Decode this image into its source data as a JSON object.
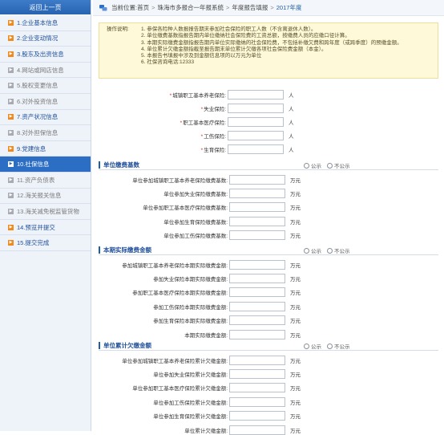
{
  "sidebar": {
    "back_label": "返回上一页",
    "items": [
      {
        "label": "1.企业基本信息",
        "state": "done"
      },
      {
        "label": "2.企业变动情况",
        "state": "done"
      },
      {
        "label": "3.股东及出资信息",
        "state": "done"
      },
      {
        "label": "4.网站或网店信息",
        "state": "todo"
      },
      {
        "label": "5.股权变更信息",
        "state": "todo"
      },
      {
        "label": "6.对外投资信息",
        "state": "todo"
      },
      {
        "label": "7.资产状况信息",
        "state": "done"
      },
      {
        "label": "8.对外担保信息",
        "state": "todo"
      },
      {
        "label": "9.党建信息",
        "state": "done"
      },
      {
        "label": "10.社保信息",
        "state": "active"
      },
      {
        "label": "11.资产负债表",
        "state": "todo"
      },
      {
        "label": "12.海关报关信息",
        "state": "todo"
      },
      {
        "label": "13.海关减免税监管货物",
        "state": "todo"
      },
      {
        "label": "14.预览并提交",
        "state": "done"
      },
      {
        "label": "15.提交完成",
        "state": "done"
      }
    ]
  },
  "breadcrumb": {
    "prefix": "当前位置:",
    "parts": [
      "首页",
      "珠海市多报合一年报系统",
      "年度报告填报"
    ],
    "current": "2017年度"
  },
  "notice": {
    "label": "操作说明:",
    "lines": [
      "1. 参保各险种人数报报告期末参加社会保险的职工人数（不含离退休人数）。",
      "2. 单位缴费基数指报告期内单位缴纳社会保险费的工资总额，按缴费人员的应缴口径计算。",
      "3. 本期实际缴费金额指报告期内单位实际缴纳的社会保险费，不包括补缴欠费和跨年度（或跨季度）的预缴金额。",
      "4. 单位累计欠缴金额指截至报告期末单位累计欠缴各项社会保险费金额（本金）。",
      "5. 本报告书填报中涉及到金额信息项的以万元为单位",
      "6. 社保咨询电话:12333"
    ]
  },
  "insured": {
    "unit": "人",
    "fields": [
      "城镇职工基本养老保险:",
      "失业保险:",
      "职工基本医疗保险:",
      "工伤保险:",
      "生育保险:"
    ]
  },
  "radio": {
    "public": "公示",
    "private": "不公示"
  },
  "money_unit": "万元",
  "sections": [
    {
      "title": "单位缴费基数",
      "fields": [
        "单位参加城镇职工基本养老保险缴费基数:",
        "单位参加失业保险缴费基数:",
        "单位参加职工基本医疗保险缴费基数:",
        "单位参加生育保险缴费基数:",
        "单位参加工伤保险缴费基数:"
      ]
    },
    {
      "title": "本期实际缴费金额",
      "fields": [
        "参加城镇职工基本养老保险本期实际缴费金额:",
        "参加失业保险本期实际缴费金额:",
        "参加职工基本医疗保险本期实际缴费金额:",
        "参加工伤保险本期实际缴费金额:",
        "参加生育保险本期实际缴费金额:",
        "本期实际缴费金额:"
      ]
    },
    {
      "title": "单位累计欠缴金额",
      "fields": [
        "单位参加城镇职工基本养老保险累计欠缴金额:",
        "单位参加失业保险累计欠缴金额:",
        "单位参加职工基本医疗保险累计欠缴金额:",
        "单位参加工伤保险累计欠缴金额:",
        "单位参加生育保险累计欠缴金额:",
        "单位累计欠缴金额:"
      ]
    }
  ]
}
